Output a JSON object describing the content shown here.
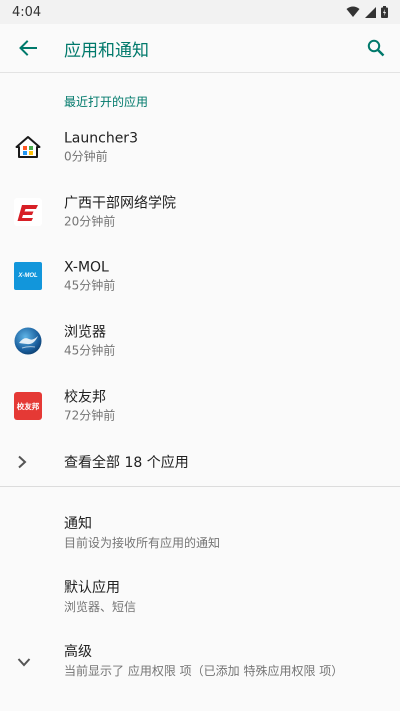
{
  "status_bar": {
    "time": "4:04"
  },
  "app_bar": {
    "title": "应用和通知"
  },
  "recent": {
    "header": "最近打开的应用",
    "apps": [
      {
        "name": "Launcher3",
        "time": "0分钟前",
        "icon": "home-icon"
      },
      {
        "name": "广西干部网络学院",
        "time": "20分钟前",
        "icon": "guangxi-cadre-logo"
      },
      {
        "name": "X-MOL",
        "time": "45分钟前",
        "icon": "xmol-logo",
        "icon_text": "X-MOL"
      },
      {
        "name": "浏览器",
        "time": "45分钟前",
        "icon": "browser-globe-icon"
      },
      {
        "name": "校友邦",
        "time": "72分钟前",
        "icon": "xiaoyoubang-logo",
        "icon_text": "校友邦"
      }
    ]
  },
  "see_all": {
    "label": "查看全部 18 个应用"
  },
  "preferences": [
    {
      "title": "通知",
      "summary": "目前设为接收所有应用的通知"
    },
    {
      "title": "默认应用",
      "summary": "浏览器、短信"
    },
    {
      "title": "高级",
      "summary": "当前显示了 应用权限 项（已添加 特殊应用权限 项）"
    }
  ],
  "colors": {
    "accent": "#00796b",
    "primary_text": "#212121",
    "secondary_text": "#757575"
  }
}
